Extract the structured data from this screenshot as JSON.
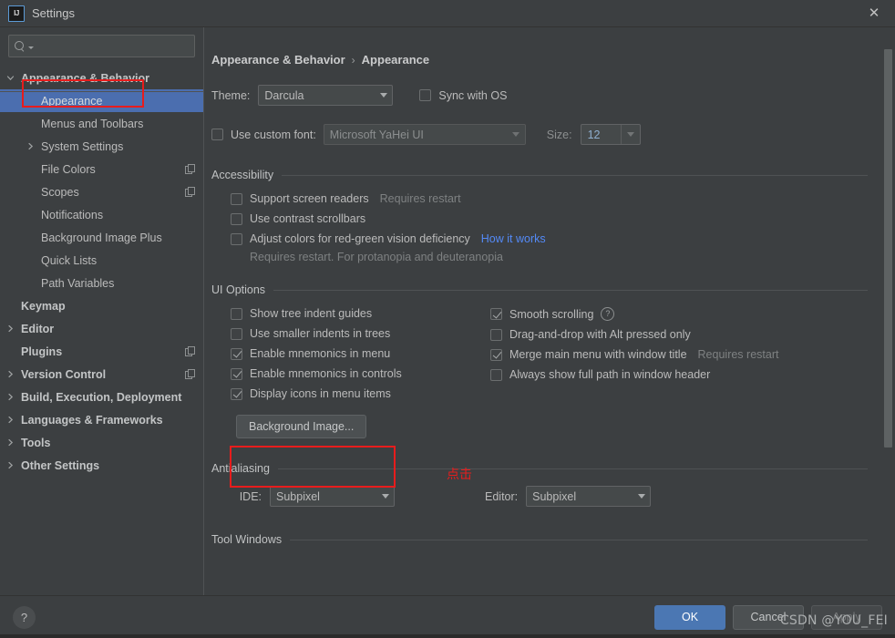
{
  "window": {
    "title": "Settings",
    "app_icon": "intellij-idea-icon",
    "close_icon": "close-icon"
  },
  "sidebar": {
    "search": {
      "placeholder": "",
      "value": "",
      "icon": "search-icon"
    },
    "items": [
      {
        "label": "Appearance & Behavior",
        "indent": 0,
        "twisty": "down",
        "top": true,
        "selected": false,
        "copy": false
      },
      {
        "label": "Appearance",
        "indent": 1,
        "twisty": "none",
        "top": false,
        "selected": true,
        "copy": false
      },
      {
        "label": "Menus and Toolbars",
        "indent": 1,
        "twisty": "none",
        "top": false,
        "selected": false,
        "copy": false
      },
      {
        "label": "System Settings",
        "indent": 1,
        "twisty": "right",
        "top": false,
        "selected": false,
        "copy": false
      },
      {
        "label": "File Colors",
        "indent": 1,
        "twisty": "none",
        "top": false,
        "selected": false,
        "copy": true
      },
      {
        "label": "Scopes",
        "indent": 1,
        "twisty": "none",
        "top": false,
        "selected": false,
        "copy": true
      },
      {
        "label": "Notifications",
        "indent": 1,
        "twisty": "none",
        "top": false,
        "selected": false,
        "copy": false
      },
      {
        "label": "Background Image Plus",
        "indent": 1,
        "twisty": "none",
        "top": false,
        "selected": false,
        "copy": false
      },
      {
        "label": "Quick Lists",
        "indent": 1,
        "twisty": "none",
        "top": false,
        "selected": false,
        "copy": false
      },
      {
        "label": "Path Variables",
        "indent": 1,
        "twisty": "none",
        "top": false,
        "selected": false,
        "copy": false
      },
      {
        "label": "Keymap",
        "indent": 0,
        "twisty": "none",
        "top": true,
        "selected": false,
        "copy": false
      },
      {
        "label": "Editor",
        "indent": 0,
        "twisty": "right",
        "top": true,
        "selected": false,
        "copy": false
      },
      {
        "label": "Plugins",
        "indent": 0,
        "twisty": "none",
        "top": true,
        "selected": false,
        "copy": true
      },
      {
        "label": "Version Control",
        "indent": 0,
        "twisty": "right",
        "top": true,
        "selected": false,
        "copy": true
      },
      {
        "label": "Build, Execution, Deployment",
        "indent": 0,
        "twisty": "right",
        "top": true,
        "selected": false,
        "copy": false
      },
      {
        "label": "Languages & Frameworks",
        "indent": 0,
        "twisty": "right",
        "top": true,
        "selected": false,
        "copy": false
      },
      {
        "label": "Tools",
        "indent": 0,
        "twisty": "right",
        "top": true,
        "selected": false,
        "copy": false
      },
      {
        "label": "Other Settings",
        "indent": 0,
        "twisty": "right",
        "top": true,
        "selected": false,
        "copy": false
      }
    ]
  },
  "main": {
    "breadcrumb": {
      "root": "Appearance & Behavior",
      "separator": "›",
      "leaf": "Appearance"
    },
    "theme": {
      "label": "Theme:",
      "value": "Darcula",
      "sync_label": "Sync with OS",
      "sync_checked": false
    },
    "font": {
      "custom_font_label": "Use custom font:",
      "custom_font_checked": false,
      "font_value": "Microsoft YaHei UI",
      "size_label": "Size:",
      "size_value": "12"
    },
    "accessibility": {
      "title": "Accessibility",
      "items": [
        {
          "label": "Support screen readers",
          "checked": false,
          "hint": "Requires restart",
          "link": ""
        },
        {
          "label": "Use contrast scrollbars",
          "checked": false,
          "hint": "",
          "link": ""
        },
        {
          "label": "Adjust colors for red-green vision deficiency",
          "checked": false,
          "hint": "",
          "link": "How it works"
        }
      ],
      "note": "Requires restart. For protanopia and deuteranopia"
    },
    "ui_options": {
      "title": "UI Options",
      "left": [
        {
          "label": "Show tree indent guides",
          "checked": false
        },
        {
          "label": "Use smaller indents in trees",
          "checked": false
        },
        {
          "label": "Enable mnemonics in menu",
          "checked": true
        },
        {
          "label": "Enable mnemonics in controls",
          "checked": true
        },
        {
          "label": "Display icons in menu items",
          "checked": true
        }
      ],
      "right": [
        {
          "label": "Smooth scrolling",
          "checked": true,
          "help": true,
          "hint": ""
        },
        {
          "label": "Drag-and-drop with Alt pressed only",
          "checked": false,
          "help": false,
          "hint": ""
        },
        {
          "label": "Merge main menu with window title",
          "checked": true,
          "help": false,
          "hint": "Requires restart"
        },
        {
          "label": "Always show full path in window header",
          "checked": false,
          "help": false,
          "hint": ""
        }
      ],
      "background_image_button": "Background Image..."
    },
    "antialiasing": {
      "title": "Antialiasing",
      "ide_label": "IDE:",
      "ide_value": "Subpixel",
      "editor_label": "Editor:",
      "editor_value": "Subpixel"
    },
    "tool_windows_title": "Tool Windows"
  },
  "annotations": [
    {
      "name": "sidebar-appearance-highlight",
      "type": "box"
    },
    {
      "name": "background-image-highlight",
      "type": "box"
    },
    {
      "name": "click-here-label",
      "type": "text",
      "text": "点击"
    }
  ],
  "footer": {
    "help_label": "?",
    "ok": "OK",
    "cancel": "Cancel",
    "apply": "Apply"
  },
  "watermark": "CSDN @YOU_FEI",
  "colors": {
    "background": "#3C3F41",
    "selection": "#4B6EAF",
    "accent_button": "#4B77B3",
    "link": "#548AF7",
    "annotation": "#E81C1C"
  }
}
